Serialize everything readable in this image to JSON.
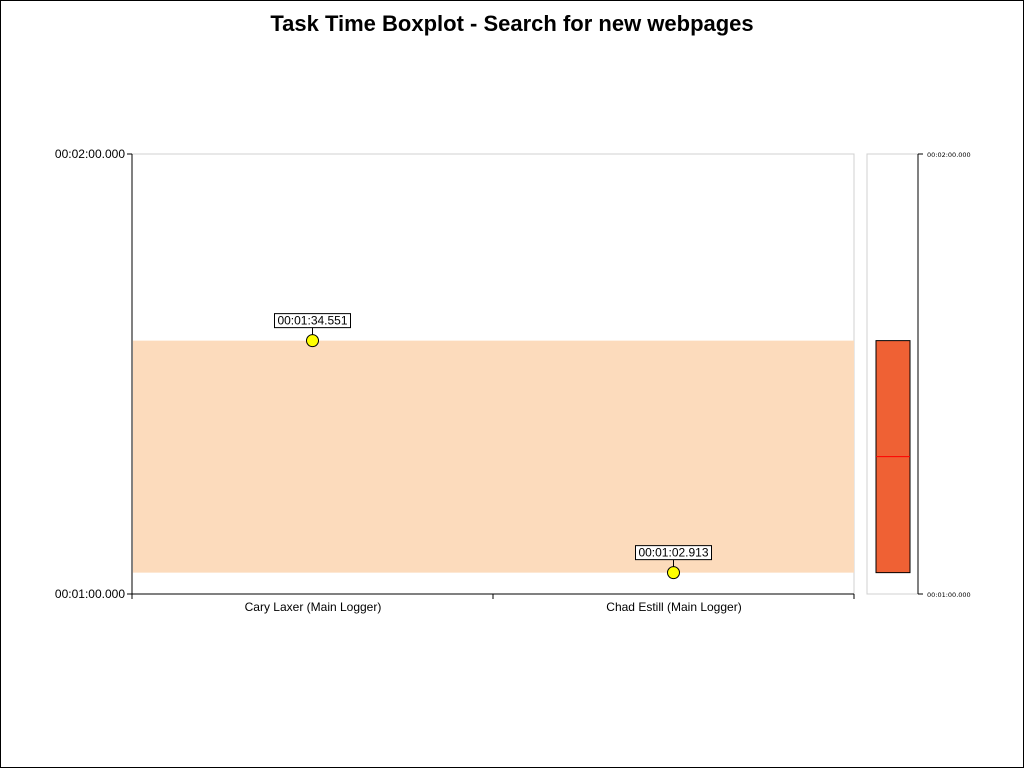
{
  "chart_data": {
    "type": "scatter",
    "title": "Task Time Boxplot - Search for new webpages",
    "ylim": [
      "00:01:00.000",
      "00:02:00.000"
    ],
    "ylim_seconds": [
      60,
      120
    ],
    "y_ticks": [
      "00:01:00.000",
      "00:02:00.000"
    ],
    "categories": [
      "Cary Laxer (Main Logger)",
      "Chad Estill (Main Logger)"
    ],
    "points": [
      {
        "category": "Cary Laxer (Main Logger)",
        "y": 94.551,
        "label": "00:01:34.551"
      },
      {
        "category": "Chad Estill (Main Logger)",
        "y": 62.913,
        "label": "00:01:02.913"
      }
    ],
    "range_band": {
      "min": 62.913,
      "max": 94.551
    },
    "boxplot": {
      "min": 62.913,
      "max": 94.551,
      "median": 78.732,
      "q1": 62.913,
      "q3": 94.551
    },
    "side_ticks": [
      "00:02:00.000",
      "00:01:00.000"
    ],
    "colors": {
      "band": "#fcdbbc",
      "box": "#ef6134",
      "median_line": "#ff0000",
      "point": "#ffff00"
    },
    "grid": false
  }
}
